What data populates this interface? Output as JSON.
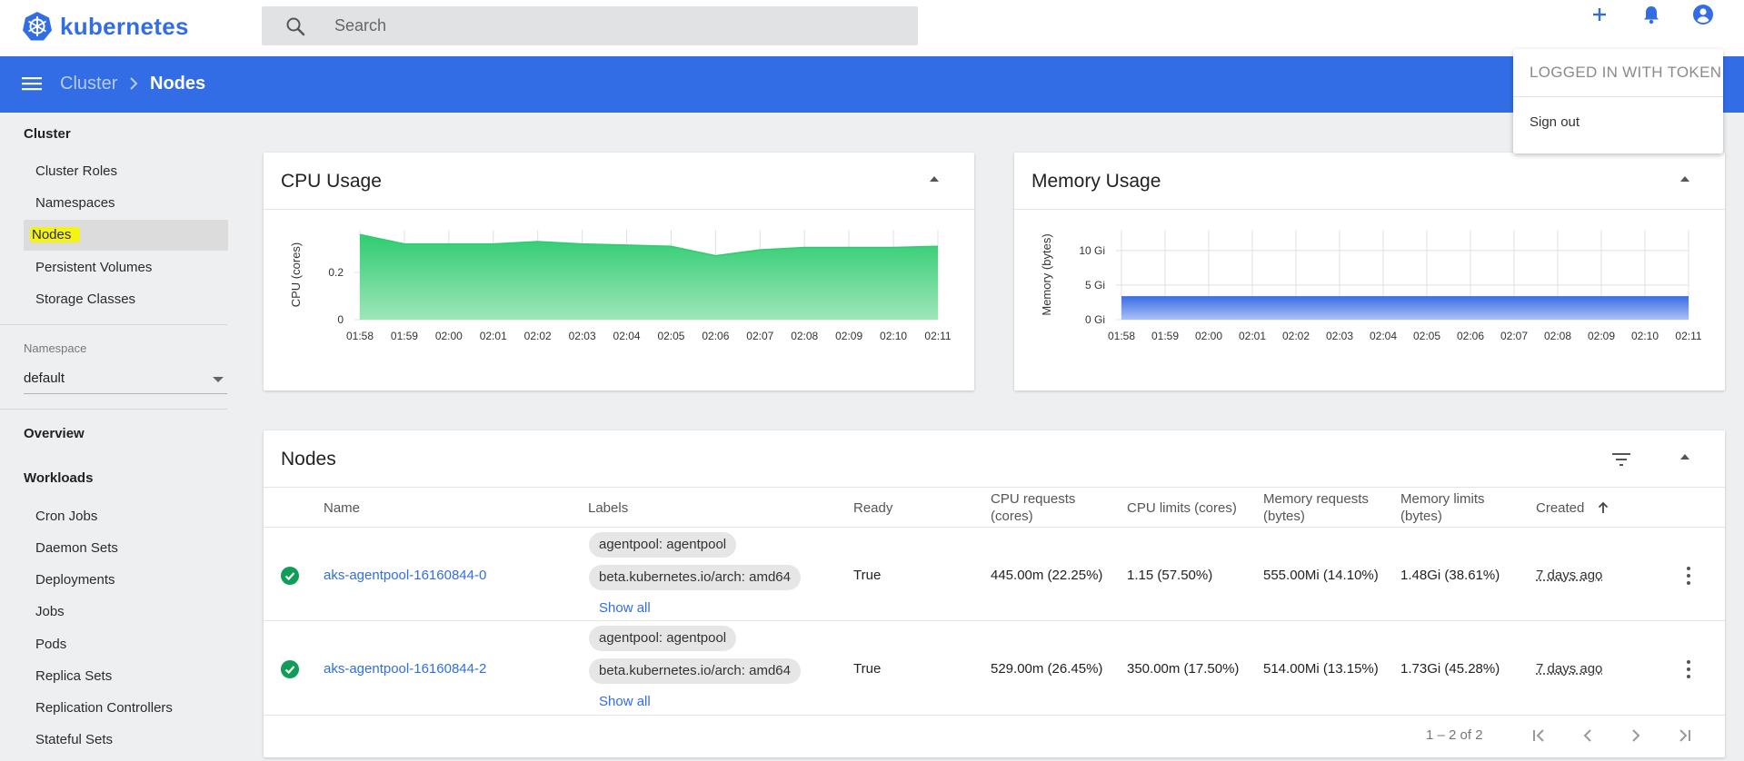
{
  "app": {
    "brand": "kubernetes",
    "brand_color": "#326de6"
  },
  "search": {
    "placeholder": "Search"
  },
  "top_actions": [
    "add-icon",
    "notifications-icon",
    "account-icon"
  ],
  "breadcrumb": {
    "parent": "Cluster",
    "current": "Nodes"
  },
  "account_menu": {
    "title": "LOGGED IN WITH TOKEN",
    "sign_out": "Sign out"
  },
  "sidebar": {
    "cluster_heading": "Cluster",
    "cluster_items": [
      "Cluster Roles",
      "Namespaces",
      "Nodes",
      "Persistent Volumes",
      "Storage Classes"
    ],
    "active_item": "Nodes",
    "namespace_label": "Namespace",
    "namespace_value": "default",
    "overview": "Overview",
    "workloads_heading": "Workloads",
    "workload_items": [
      "Cron Jobs",
      "Daemon Sets",
      "Deployments",
      "Jobs",
      "Pods",
      "Replica Sets",
      "Replication Controllers",
      "Stateful Sets"
    ]
  },
  "cpu_card": {
    "title": "CPU Usage"
  },
  "memory_card": {
    "title": "Memory Usage"
  },
  "chart_data": [
    {
      "type": "area",
      "title": "CPU Usage",
      "ylabel": "CPU (cores)",
      "x": [
        "01:58",
        "01:59",
        "02:00",
        "02:01",
        "02:02",
        "02:03",
        "02:04",
        "02:05",
        "02:06",
        "02:07",
        "02:08",
        "02:09",
        "02:10",
        "02:11"
      ],
      "series": [
        {
          "values": [
            0.36,
            0.32,
            0.32,
            0.32,
            0.33,
            0.32,
            0.315,
            0.31,
            0.27,
            0.295,
            0.305,
            0.305,
            0.305,
            0.31
          ]
        }
      ],
      "yticks": [
        "0",
        "0.2"
      ],
      "ylim": [
        0,
        0.38
      ],
      "grid": true,
      "color": "#2ecc71"
    },
    {
      "type": "area",
      "title": "Memory Usage",
      "ylabel": "Memory (bytes)",
      "x": [
        "01:58",
        "01:59",
        "02:00",
        "02:01",
        "02:02",
        "02:03",
        "02:04",
        "02:05",
        "02:06",
        "02:07",
        "02:08",
        "02:09",
        "02:10",
        "02:11"
      ],
      "series": [
        {
          "values": [
            3.3,
            3.3,
            3.3,
            3.3,
            3.3,
            3.3,
            3.3,
            3.3,
            3.3,
            3.3,
            3.3,
            3.3,
            3.3,
            3.3
          ]
        }
      ],
      "yticks": [
        "0 Gi",
        "5 Gi",
        "10 Gi"
      ],
      "ytick_values": [
        0,
        5,
        10
      ],
      "ylim": [
        0,
        13
      ],
      "grid": true,
      "color": "#3b6fe6"
    }
  ],
  "nodes": {
    "title": "Nodes",
    "columns": [
      "Name",
      "Labels",
      "Ready",
      "CPU requests (cores)",
      "CPU limits (cores)",
      "Memory requests (bytes)",
      "Memory limits (bytes)",
      "Created"
    ],
    "rows": [
      {
        "name": "aks-agentpool-16160844-0",
        "labels": [
          "agentpool: agentpool",
          "beta.kubernetes.io/arch: amd64"
        ],
        "show_all": "Show all",
        "ready": "True",
        "cpu_requests": "445.00m (22.25%)",
        "cpu_limits": "1.15 (57.50%)",
        "memory_requests": "555.00Mi (14.10%)",
        "memory_limits": "1.48Gi (38.61%)",
        "created": "7 days ago"
      },
      {
        "name": "aks-agentpool-16160844-2",
        "labels": [
          "agentpool: agentpool",
          "beta.kubernetes.io/arch: amd64"
        ],
        "show_all": "Show all",
        "ready": "True",
        "cpu_requests": "529.00m (26.45%)",
        "cpu_limits": "350.00m (17.50%)",
        "memory_requests": "514.00Mi (13.15%)",
        "memory_limits": "1.73Gi (45.28%)",
        "created": "7 days ago"
      }
    ],
    "pagination": "1 – 2 of 2"
  }
}
